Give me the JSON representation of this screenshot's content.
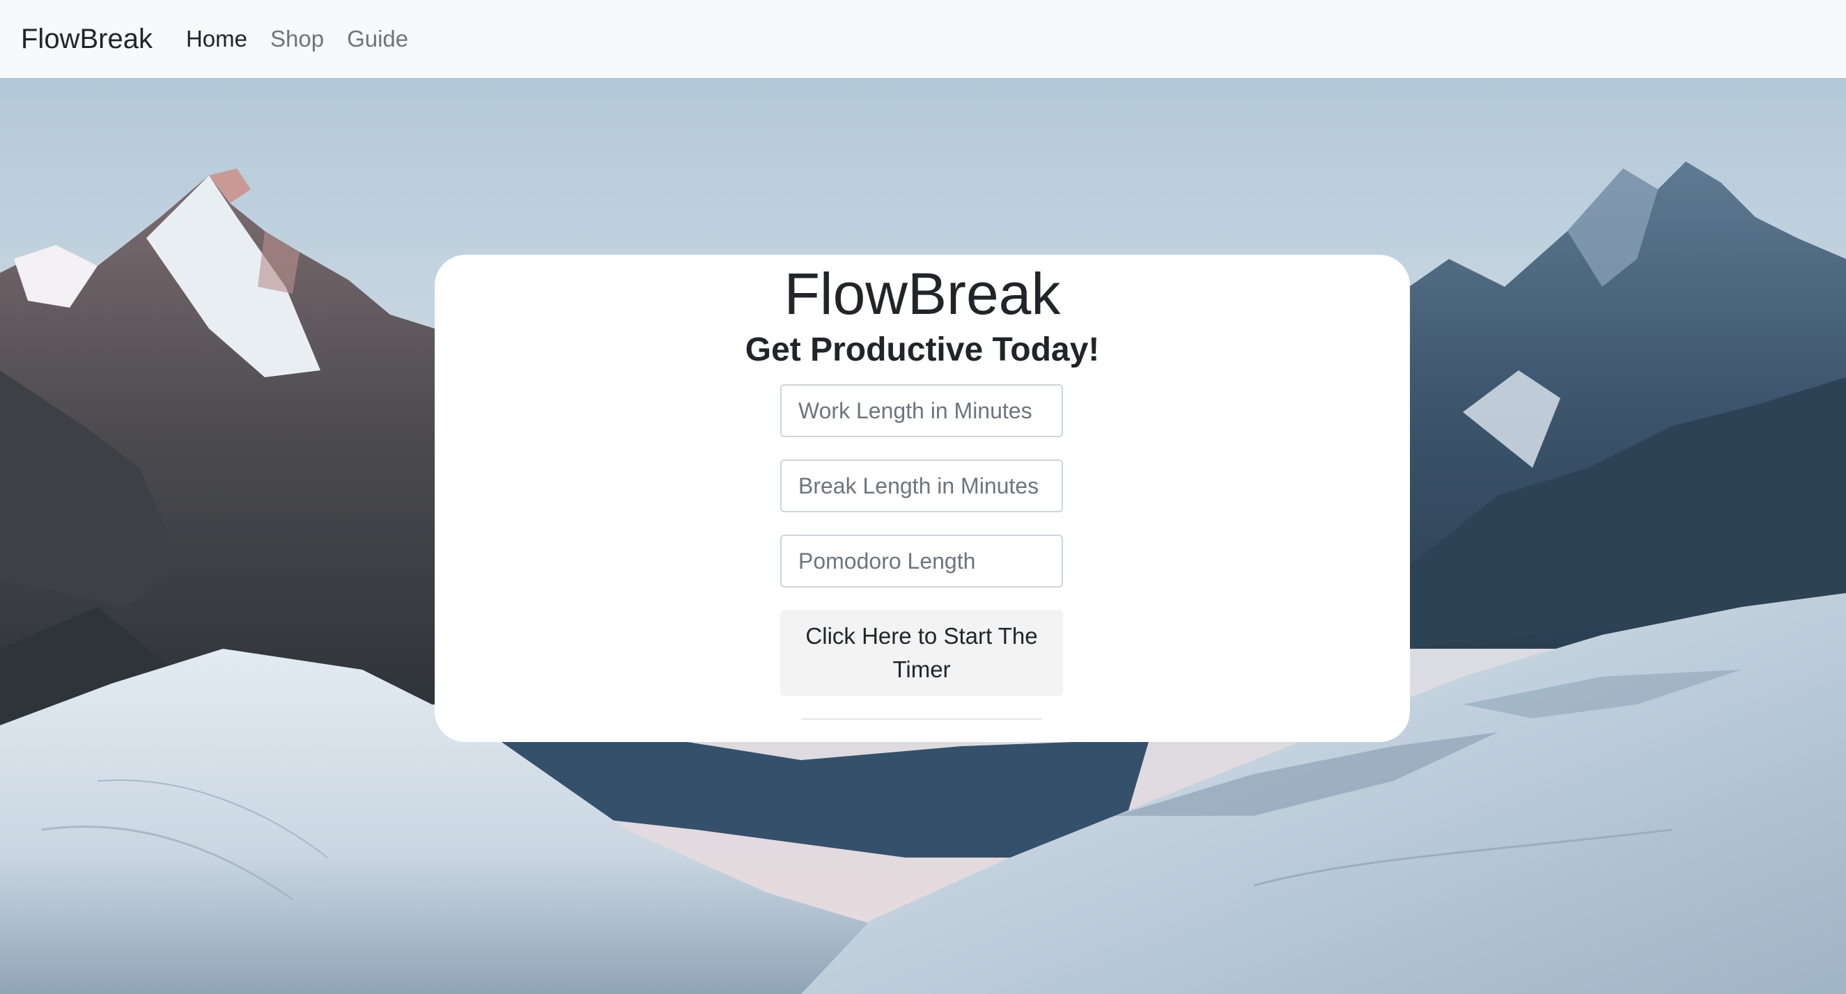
{
  "navbar": {
    "brand": "FlowBreak",
    "links": [
      {
        "label": "Home",
        "active": true
      },
      {
        "label": "Shop",
        "active": false
      },
      {
        "label": "Guide",
        "active": false
      }
    ]
  },
  "card": {
    "title": "FlowBreak",
    "subtitle": "Get Productive Today!",
    "work_field": {
      "placeholder": "Work Length in Minutes",
      "value": ""
    },
    "break_field": {
      "placeholder": "Break Length in Minutes",
      "value": ""
    },
    "pomodoro_field": {
      "placeholder": "Pomodoro Length",
      "value": ""
    },
    "start_button_label": "Click Here to Start The Timer"
  },
  "colors": {
    "navbar_bg": "#f8f9fa",
    "text_dark": "#212529",
    "nav_muted": "#6c757d",
    "card_bg": "#ffffff",
    "button_bg": "#f3f3f3"
  }
}
